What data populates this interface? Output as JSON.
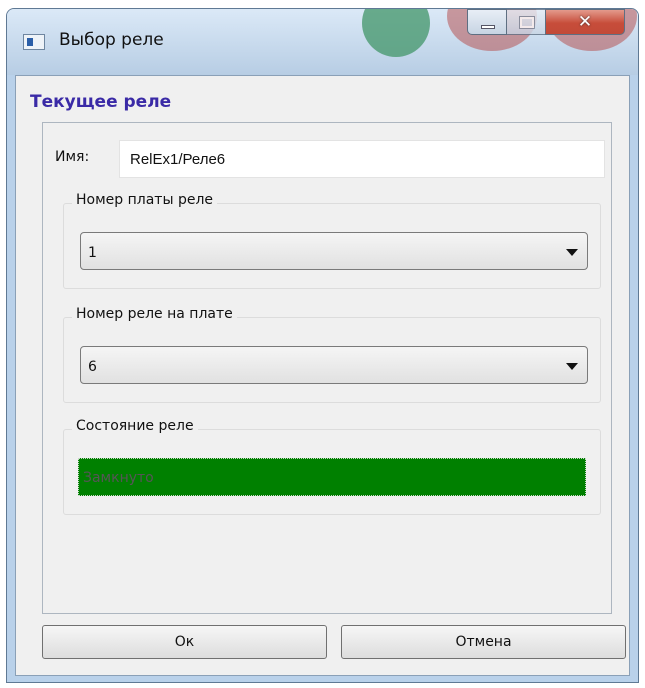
{
  "window": {
    "title": "Выбор реле",
    "controls": {
      "minimize": "minimize-icon",
      "maximize": "maximize-icon",
      "close": "close-icon"
    }
  },
  "panel": {
    "heading": "Текущее реле",
    "name_label": "Имя:",
    "name_value": "RelEx1/Реле6",
    "board_group": {
      "title": "Номер платы реле",
      "selected": "1"
    },
    "relay_group": {
      "title": "Номер реле на плате",
      "selected": "6"
    },
    "state_group": {
      "title": "Состояние реле",
      "value": "Замкнуто",
      "color": "#008000"
    }
  },
  "buttons": {
    "ok": "Ок",
    "cancel": "Отмена"
  },
  "colors": {
    "heading": "#3a2aa6",
    "frame": "#b9d1ea",
    "close_button": "#c74d3a"
  }
}
